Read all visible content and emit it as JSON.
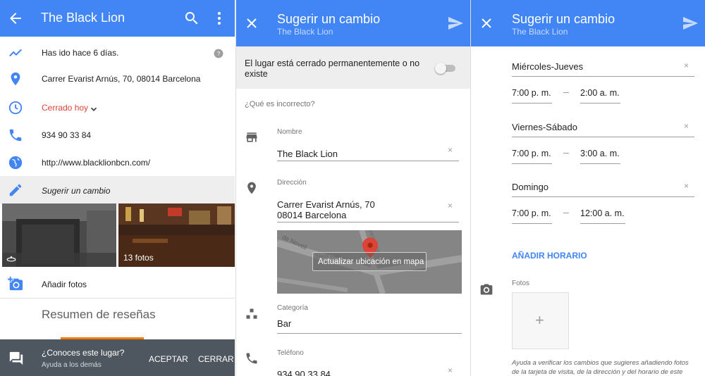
{
  "panel1": {
    "title": "The Black Lion",
    "rows": [
      {
        "label": "Has ido hace 6 días."
      },
      {
        "label": "Carrer Evarist Arnús, 70, 08014 Barcelona"
      },
      {
        "label": "Cerrado hoy"
      },
      {
        "label": "934 90 33 84"
      },
      {
        "label": "http://www.blacklionbcn.com/"
      },
      {
        "label": "Sugerir un cambio"
      }
    ],
    "photo_count": "13 fotos",
    "add_photos": "Añadir fotos",
    "reviews_title": "Resumen de reseñas",
    "bottom": {
      "question": "¿Conoces este lugar?",
      "help": "Ayuda a los demás",
      "accept": "ACEPTAR",
      "close": "CERRAR"
    }
  },
  "panel2": {
    "title": "Sugerir un cambio",
    "subtitle": "The Black Lion",
    "closed_text": "El lugar está cerrado permanentemente o no existe",
    "what_wrong": "¿Qué es incorrecto?",
    "name_label": "Nombre",
    "name_value": "The Black Lion",
    "address_label": "Dirección",
    "address_line1": "Carrer Evarist Arnús, 70",
    "address_line2": "08014 Barcelona",
    "map_button": "Actualizar ubicación en mapa",
    "map_street": "de Novell",
    "map_street2": "Barcelona",
    "map_poi": "Black Lion",
    "category_label": "Categoría",
    "category_value": "Bar",
    "phone_label": "Teléfono",
    "phone_value": "934 90 33 84"
  },
  "panel3": {
    "title": "Sugerir un cambio",
    "subtitle": "The Black Lion",
    "schedules": [
      {
        "days": "Miércoles-Jueves",
        "open": "7:00 p. m.",
        "close": "2:00 a. m."
      },
      {
        "days": "Viernes-Sábado",
        "open": "7:00 p. m.",
        "close": "3:00 a. m."
      },
      {
        "days": "Domingo",
        "open": "7:00 p. m.",
        "close": "12:00 a. m."
      }
    ],
    "add_hours": "AÑADIR HORARIO",
    "photos_label": "Fotos",
    "help_line1": "Ayuda a verificar los cambios que sugieres añadiendo fotos",
    "help_line2": "de la tarjeta de visita, de la dirección y del horario de este"
  },
  "colors": {
    "primary": "#4285f4",
    "closed_red": "#db4437",
    "bottom_bar": "#4e5660"
  }
}
